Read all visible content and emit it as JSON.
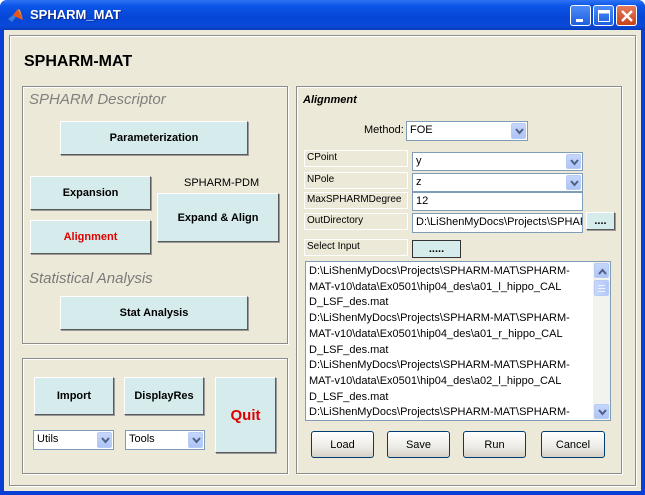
{
  "window": {
    "title": "SPHARM_MAT",
    "icon": "matlab-logo-icon",
    "controls": [
      "minimize-icon",
      "maximize-icon",
      "close-icon"
    ]
  },
  "app_title": "SPHARM-MAT",
  "descriptor": {
    "title": "SPHARM Descriptor",
    "parameterization": "Parameterization",
    "expansion": "Expansion",
    "pdm_label": "SPHARM-PDM",
    "expand_align": "Expand & Align",
    "alignment": "Alignment",
    "alignment_color": "#e00000",
    "statistical_title": "Statistical Analysis",
    "stat_analysis": "Stat Analysis"
  },
  "bottom": {
    "import": "Import",
    "displayres": "DisplayRes",
    "quit": "Quit",
    "quit_color": "#e00000",
    "utils": "Utils",
    "tools": "Tools"
  },
  "alignment": {
    "title": "Alignment",
    "method_label": "Method:",
    "method_value": "FOE",
    "cpoint_label": "CPoint",
    "cpoint_value": "y",
    "npole_label": "NPole",
    "npole_value": "z",
    "maxdeg_label": "MaxSPHARMDegree",
    "maxdeg_value": "12",
    "outdir_label": "OutDirectory",
    "outdir_value": "D:\\LiShenMyDocs\\Projects\\SPHARI",
    "browse_btn": "....",
    "select_input_label": "Select Input",
    "select_input_btn": ".....",
    "files": [
      "D:\\LiShenMyDocs\\Projects\\SPHARM-MAT\\SPHARM-",
      "MAT-v10\\data\\Ex0501\\hip04_des\\a01_l_hippo_CAL",
      "D_LSF_des.mat",
      "D:\\LiShenMyDocs\\Projects\\SPHARM-MAT\\SPHARM-",
      "MAT-v10\\data\\Ex0501\\hip04_des\\a01_r_hippo_CAL",
      "D_LSF_des.mat",
      "D:\\LiShenMyDocs\\Projects\\SPHARM-MAT\\SPHARM-",
      "MAT-v10\\data\\Ex0501\\hip04_des\\a02_l_hippo_CAL",
      "D_LSF_des.mat",
      "D:\\LiShenMyDocs\\Projects\\SPHARM-MAT\\SPHARM-"
    ],
    "load": "Load",
    "save": "Save",
    "run": "Run",
    "cancel": "Cancel"
  }
}
